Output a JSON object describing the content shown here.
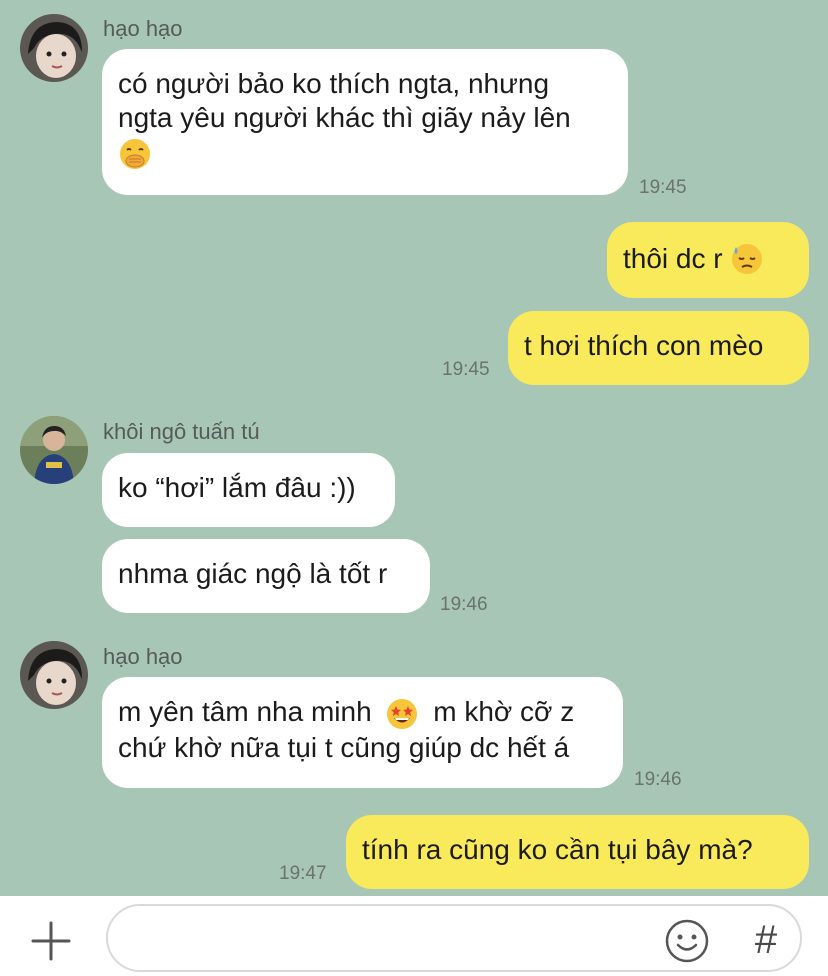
{
  "messages": [
    {
      "sender": "hạo hạo",
      "lines": [
        "có người bảo ko thích ngta, nhưng",
        "ngta yêu người khác thì giãy nảy lên"
      ],
      "emoji": "face-with-hand-over-mouth",
      "time": "19:45"
    },
    {
      "lines": [
        "thôi dc r"
      ],
      "emoji": "downcast-face-with-sweat"
    },
    {
      "lines": [
        "t hơi thích con mèo"
      ],
      "time": "19:45"
    },
    {
      "sender": "khôi ngô tuấn tú",
      "lines": [
        "ko “hơi” lắm đâu :))"
      ]
    },
    {
      "lines": [
        "nhma giác ngộ là tốt r"
      ],
      "time": "19:46"
    },
    {
      "sender": "hạo hạo",
      "line1_before": "m yên tâm nha minh",
      "line1_after": "m khờ cỡ z",
      "lines": [
        "chứ khờ nữa tụi t cũng giúp dc hết á"
      ],
      "emoji": "star-struck",
      "time": "19:46"
    },
    {
      "lines": [
        "tính ra cũng ko cần tụi bây mà?"
      ],
      "time": "19:47"
    }
  ],
  "composer": {
    "plus_icon": "plus-icon",
    "input_value": "",
    "emoji_icon": "smiley-icon",
    "hash_label": "#"
  },
  "colors": {
    "background": "#a8c6b5",
    "incoming_bubble": "#ffffff",
    "outgoing_bubble": "#f9ea5c"
  }
}
